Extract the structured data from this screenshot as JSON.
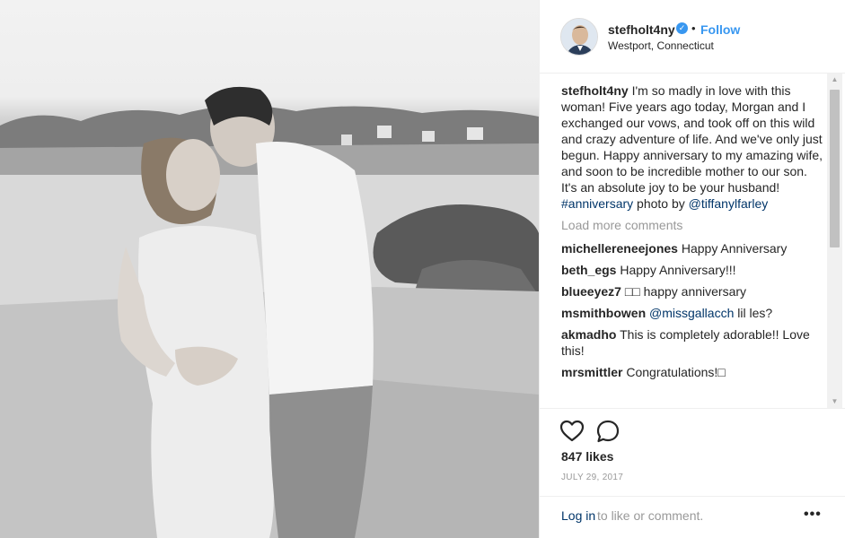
{
  "post": {
    "username": "stefholt4ny",
    "follow_label": "Follow",
    "separator": "•",
    "location": "Westport, Connecticut"
  },
  "caption": {
    "username": "stefholt4ny",
    "text": "I'm so madly in love with this woman! Five years ago today, Morgan and I exchanged our vows, and took off on this wild and crazy adventure of life. And we've only just begun. Happy anniversary to my amazing wife, and soon to be incredible mother to our son. It's an absolute joy to be your husband!",
    "hashtag": "#anniversary",
    "credit": "photo by",
    "mention": "@tiffanylfarley"
  },
  "load_more": "Load more comments",
  "comments": [
    {
      "user": "michellereneejones",
      "text": "Happy Anniversary",
      "mention": ""
    },
    {
      "user": "beth_egs",
      "text": "Happy Anniversary!!!",
      "mention": ""
    },
    {
      "user": "blueeyez7",
      "text": "□□ happy anniversary",
      "mention": ""
    },
    {
      "user": "msmithbowen",
      "text": "lil les?",
      "mention": "@missgallacch"
    },
    {
      "user": "akmadho",
      "text": "This is completely adorable!! Love this!",
      "mention": ""
    },
    {
      "user": "mrsmittler",
      "text": "Congratulations!□",
      "mention": ""
    }
  ],
  "icons": {
    "like": "heart-icon",
    "comment": "comment-icon",
    "more": "more-options-icon",
    "verified": "verified-badge-icon"
  },
  "stats": {
    "likes": "847 likes",
    "date": "JULY 29, 2017"
  },
  "login": {
    "link": "Log in",
    "rest": "to like or comment.",
    "more": "•••"
  },
  "colors": {
    "accent": "#3897f0",
    "link": "#003569",
    "muted": "#999999",
    "text": "#262626"
  }
}
